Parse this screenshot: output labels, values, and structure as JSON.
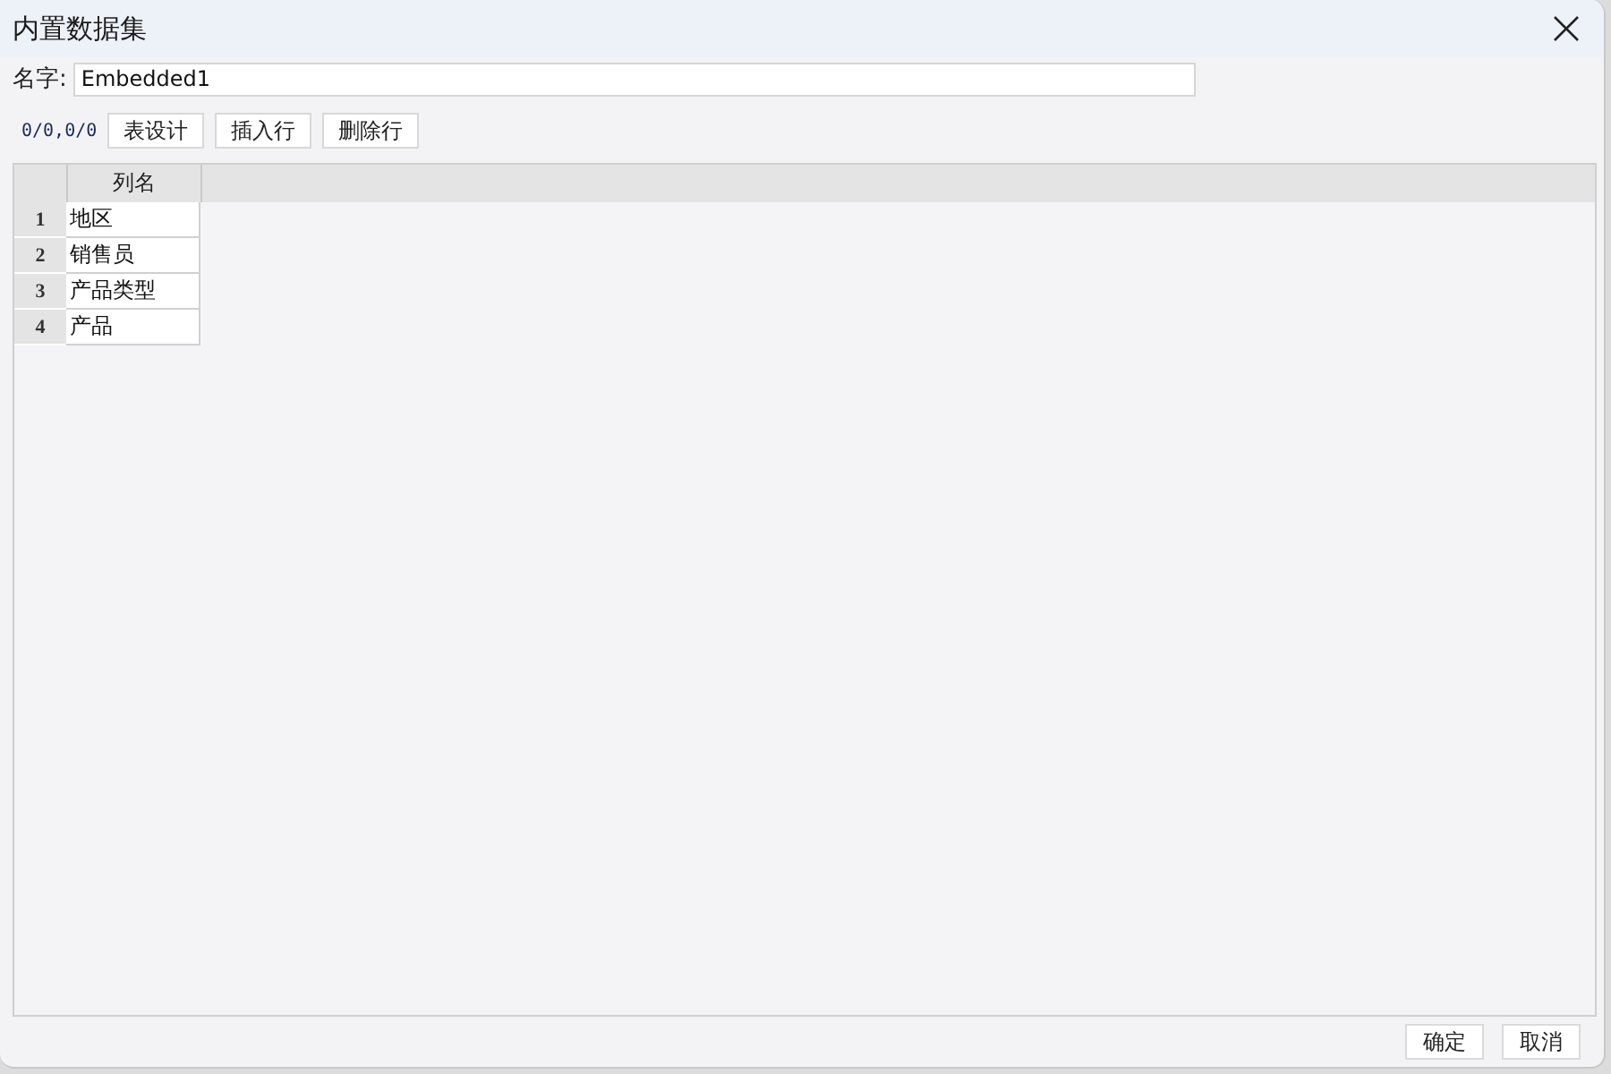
{
  "window": {
    "title": "内置数据集"
  },
  "name_field": {
    "label": "名字:",
    "value": "Embedded1"
  },
  "toolbar": {
    "position": "0/0,0/0",
    "buttons": [
      "表设计",
      "插入行",
      "删除行"
    ]
  },
  "table": {
    "columns": [
      "列名"
    ],
    "rows": [
      {
        "number": "1",
        "cells": [
          "地区"
        ]
      },
      {
        "number": "2",
        "cells": [
          "销售员"
        ]
      },
      {
        "number": "3",
        "cells": [
          "产品类型"
        ]
      },
      {
        "number": "4",
        "cells": [
          "产品"
        ]
      }
    ]
  },
  "footer_buttons": [
    "确定",
    "取消"
  ]
}
